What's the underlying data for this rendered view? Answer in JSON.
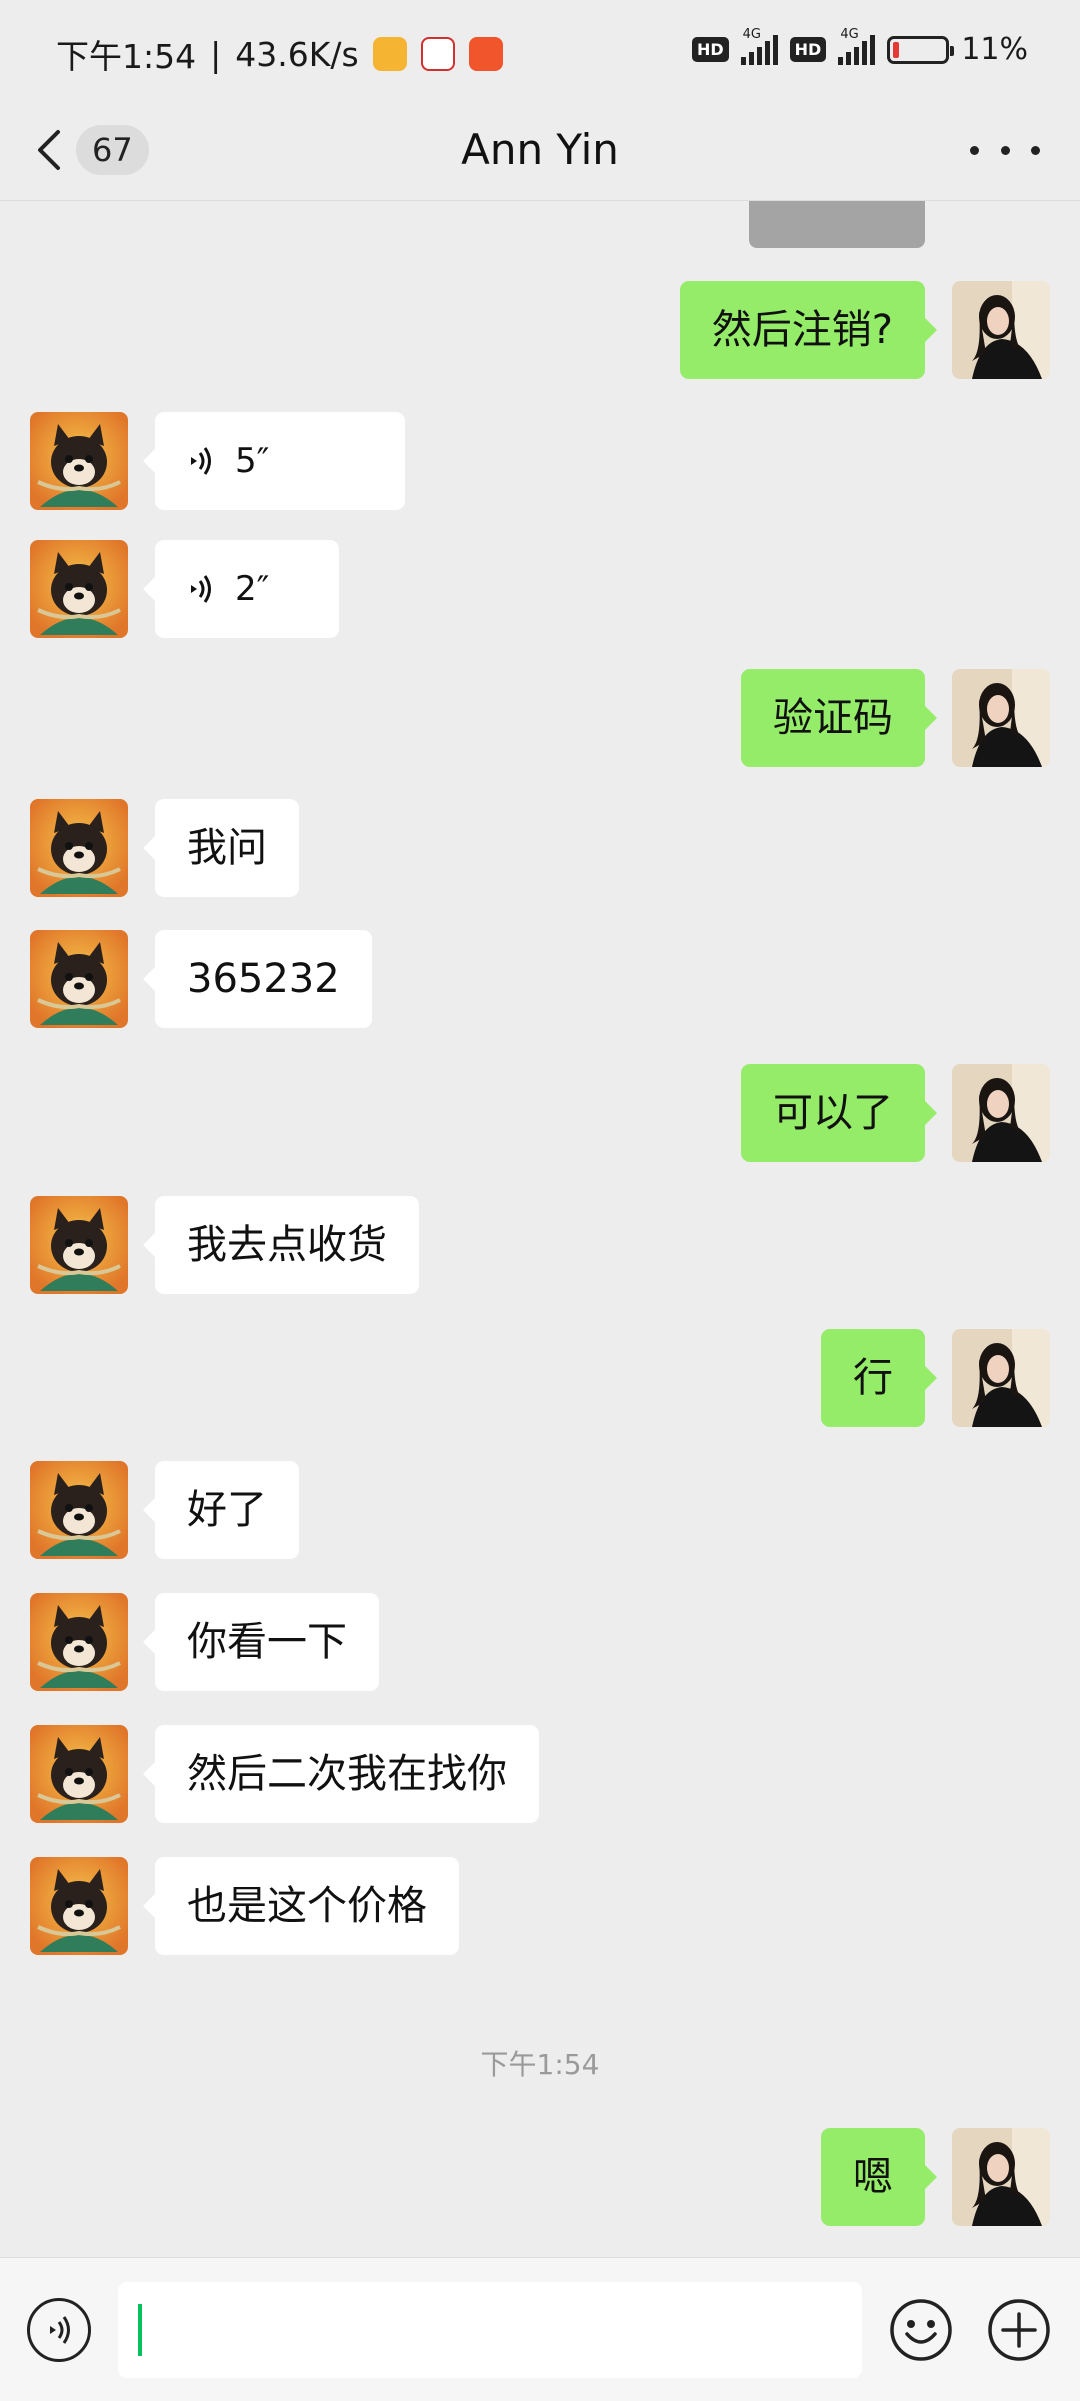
{
  "status_bar": {
    "time": "下午1:54",
    "net_speed": "43.6K/s",
    "hd_label": "HD",
    "network_type": "4G",
    "battery": "11%",
    "battery_level": 0.11
  },
  "header": {
    "unread_count": "67",
    "title": "Ann Yin"
  },
  "messages": [
    {
      "side": "out",
      "text": "然后注销?"
    },
    {
      "side": "in",
      "voice": true,
      "duration": "5″"
    },
    {
      "side": "in",
      "voice": true,
      "duration": "2″"
    },
    {
      "side": "out",
      "text": "验证码"
    },
    {
      "side": "in",
      "text": "我问"
    },
    {
      "side": "in",
      "text": "365232"
    },
    {
      "side": "out",
      "text": "可以了"
    },
    {
      "side": "in",
      "text": "我去点收货"
    },
    {
      "side": "out",
      "text": "行"
    },
    {
      "side": "in",
      "text": "好了"
    },
    {
      "side": "in",
      "text": "你看一下"
    },
    {
      "side": "in",
      "text": "然后二次我在找你"
    },
    {
      "side": "in",
      "text": "也是这个价格"
    },
    {
      "timestamp": "下午1:54"
    },
    {
      "side": "out",
      "text": "嗯"
    }
  ],
  "input_bar": {
    "draft": ""
  },
  "colors": {
    "background": "#ededed",
    "outgoing_bubble": "#95ec69",
    "incoming_bubble": "#ffffff",
    "caret": "#07c160",
    "battery_low": "#e53935"
  },
  "icons": {
    "back": "chevron-left-icon",
    "more": "more-dots-icon",
    "voice": "voice-waves-icon",
    "emoji": "emoji-smile-icon",
    "plus": "plus-circle-icon"
  }
}
